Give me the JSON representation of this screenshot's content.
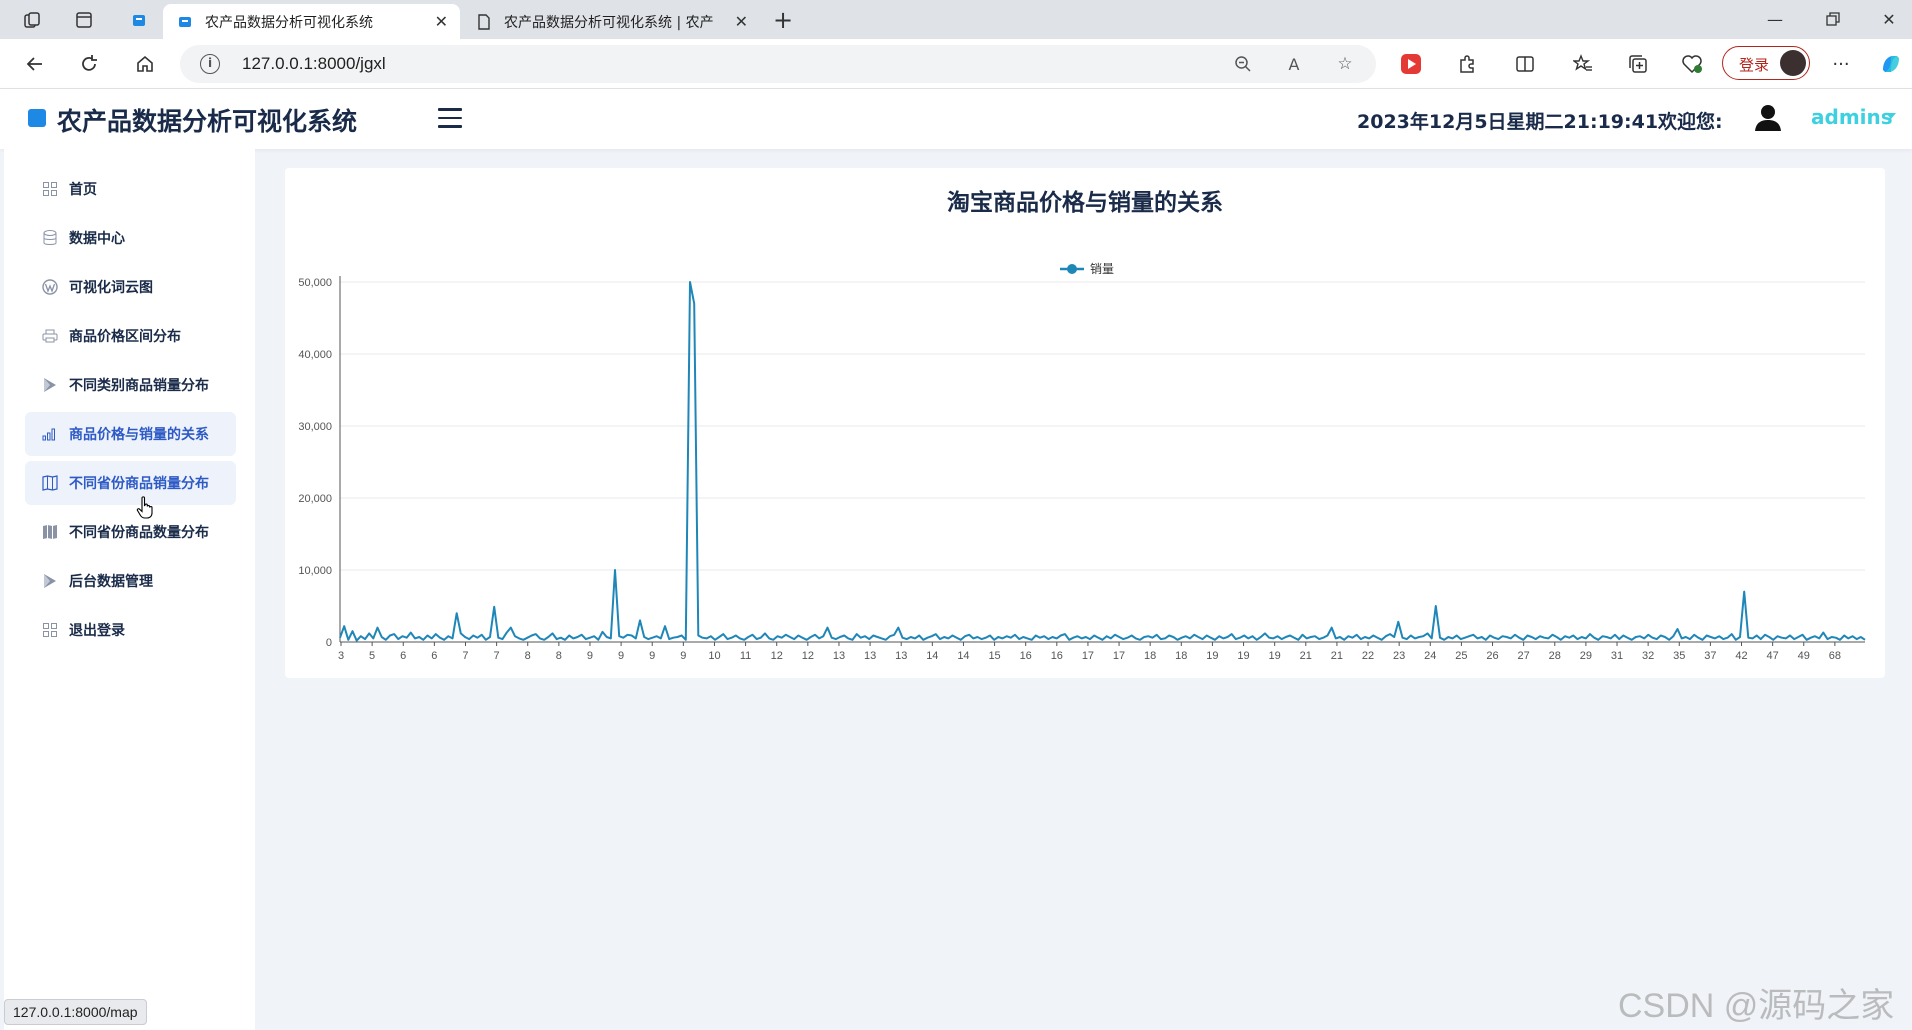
{
  "browser": {
    "tabs": [
      {
        "title": "农产品数据分析可视化系统",
        "active": true
      },
      {
        "title": "农产品数据分析可视化系统 | 农产",
        "active": false
      }
    ],
    "url": "127.0.0.1:8000/jgxl",
    "login_label": "登录",
    "status_url": "127.0.0.1:8000/map"
  },
  "header": {
    "title": "农产品数据分析可视化系统",
    "datetime": "2023年12月5日星期二21:19:41",
    "welcome": "欢迎您:",
    "username": "admins"
  },
  "sidebar": {
    "items": [
      {
        "label": "首页",
        "icon": "grid-icon"
      },
      {
        "label": "数据中心",
        "icon": "database-icon"
      },
      {
        "label": "可视化词云图",
        "icon": "wordpress-icon"
      },
      {
        "label": "商品价格区间分布",
        "icon": "printer-icon"
      },
      {
        "label": "不同类别商品销量分布",
        "icon": "play-icon"
      },
      {
        "label": "商品价格与销量的关系",
        "icon": "bar-chart-icon",
        "active": true
      },
      {
        "label": "不同省份商品销量分布",
        "icon": "map-icon",
        "hovered": true
      },
      {
        "label": "不同省份商品数量分布",
        "icon": "map-filled-icon"
      },
      {
        "label": "后台数据管理",
        "icon": "play-icon"
      },
      {
        "label": "退出登录",
        "icon": "grid-icon"
      }
    ]
  },
  "chart_data": {
    "type": "line",
    "title": "淘宝商品价格与销量的关系",
    "legend": [
      "销量"
    ],
    "legend_position": "top-center",
    "ylim": [
      0,
      50000
    ],
    "y_ticks": [
      "0",
      "10,000",
      "20,000",
      "30,000",
      "40,000",
      "50,000"
    ],
    "x_tick_labels": [
      "3",
      "5",
      "6",
      "6",
      "7",
      "7",
      "8",
      "8",
      "9",
      "9",
      "9",
      "9",
      "10",
      "11",
      "12",
      "12",
      "13",
      "13",
      "13",
      "14",
      "14",
      "15",
      "16",
      "16",
      "17",
      "17",
      "18",
      "18",
      "19",
      "19",
      "19",
      "21",
      "21",
      "22",
      "23",
      "24",
      "25",
      "26",
      "27",
      "28",
      "29",
      "31",
      "32",
      "35",
      "37",
      "42",
      "47",
      "49",
      "68"
    ],
    "grid": true,
    "color": "#1f86b8",
    "series": [
      {
        "name": "销量",
        "values": [
          600,
          2200,
          300,
          1500,
          200,
          800,
          400,
          1200,
          500,
          2000,
          700,
          300,
          900,
          1100,
          400,
          800,
          600,
          1300,
          500,
          700,
          300,
          900,
          500,
          1100,
          600,
          300,
          800,
          500,
          4000,
          1200,
          700,
          400,
          900,
          600,
          1000,
          300,
          700,
          4900,
          600,
          400,
          1300,
          2000,
          800,
          500,
          300,
          600,
          900,
          1100,
          500,
          300,
          700,
          1200,
          400,
          600,
          300,
          900,
          500,
          700,
          1000,
          400,
          600,
          800,
          300,
          1400,
          700,
          500,
          10000,
          800,
          600,
          1000,
          900,
          500,
          3000,
          700,
          400,
          600,
          800,
          500,
          2200,
          400,
          600,
          700,
          900,
          300,
          50000,
          47000,
          900,
          600,
          500,
          800,
          300,
          700,
          1100,
          400,
          600,
          900,
          500,
          300,
          700,
          1000,
          400,
          600,
          1200,
          500,
          300,
          800,
          600,
          1000,
          700,
          400,
          900,
          600,
          300,
          700,
          1000,
          500,
          800,
          2000,
          600,
          400,
          700,
          900,
          500,
          300,
          1100,
          600,
          800,
          400,
          900,
          700,
          500,
          300,
          800,
          1000,
          2000,
          600,
          400,
          700,
          500,
          900,
          300,
          600,
          800,
          1100,
          400,
          700,
          500,
          900,
          600,
          300,
          800,
          1000,
          500,
          700,
          400,
          600,
          900,
          300,
          700,
          500,
          800,
          600,
          1000,
          400,
          700,
          500,
          300,
          900,
          600,
          800,
          400,
          700,
          500,
          900,
          1100,
          300,
          600,
          800,
          500,
          700,
          400,
          900,
          600,
          300,
          800,
          500,
          1000,
          700,
          400,
          600,
          900,
          500,
          300,
          700,
          800,
          600,
          1000,
          400,
          500,
          900,
          700,
          300,
          600,
          800,
          500,
          1000,
          700,
          400,
          900,
          600,
          300,
          800,
          500,
          700,
          1100,
          400,
          600,
          900,
          500,
          800,
          300,
          700,
          1200,
          600,
          500,
          800,
          400,
          700,
          900,
          600,
          300,
          1000,
          500,
          700,
          800,
          400,
          600,
          900,
          2000,
          500,
          700,
          300,
          800,
          600,
          1000,
          400,
          700,
          500,
          900,
          600,
          300,
          800,
          1100,
          700,
          2800,
          600,
          400,
          900,
          500,
          700,
          800,
          1200,
          500,
          5000,
          600,
          300,
          700,
          500,
          900,
          400,
          600,
          800,
          1000,
          500,
          700,
          300,
          900,
          600,
          400,
          800,
          700,
          500,
          1000,
          600,
          300,
          900,
          700,
          400,
          800,
          600,
          500,
          1000,
          700,
          300,
          800,
          600,
          900,
          400,
          700,
          500,
          1100,
          600,
          300,
          800,
          700,
          500,
          1000,
          400,
          900,
          600,
          300,
          700,
          800,
          500,
          1000,
          600,
          400,
          900,
          700,
          300,
          800,
          1800,
          500,
          700,
          400,
          1000,
          600,
          300,
          900,
          700,
          500,
          800,
          400,
          600,
          1100,
          300,
          700,
          7000,
          600,
          500,
          900,
          400,
          1000,
          700,
          300,
          800,
          600,
          500,
          900,
          400,
          700,
          1000,
          300,
          600,
          800,
          500,
          1300,
          400,
          700,
          600,
          300,
          900,
          500,
          800,
          400,
          700,
          300
        ]
      }
    ]
  }
}
